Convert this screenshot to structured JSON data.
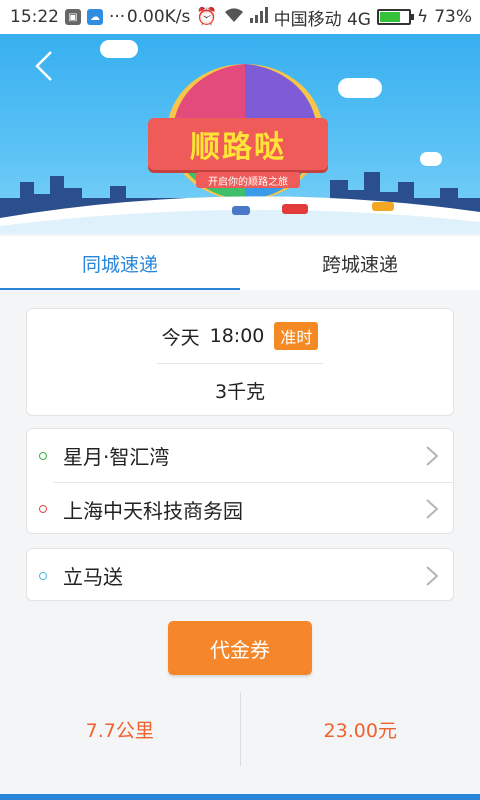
{
  "status_bar": {
    "time": "15:22",
    "dots": "···",
    "speed": "0.00K/s",
    "carrier": "中国移动 4G",
    "battery": "73%",
    "battery_level": 0.73
  },
  "banner": {
    "title": "顺路哒",
    "subtitle": "开启你的顺路之旅",
    "colors": {
      "sky": "#37aff0",
      "ribbon": "#ef5b58",
      "title_text": "#ffe437"
    }
  },
  "icons": {
    "back": "chevron-left-icon",
    "row_arrow": "chevron-right-icon"
  },
  "tabs": [
    {
      "label": "同城速递",
      "active": true
    },
    {
      "label": "跨城速递",
      "active": false
    }
  ],
  "delivery": {
    "day": "今天",
    "time": "18:00",
    "badge": "准时",
    "weight": "3千克"
  },
  "addresses": {
    "from": "星月·智汇湾",
    "to": "上海中天科技商务园"
  },
  "service": "立马送",
  "coupon_button": "代金券",
  "summary": {
    "distance": "7.7公里",
    "price": "23.00元"
  },
  "accent_colors": {
    "primary": "#2a86d8",
    "orange": "#f58a24",
    "price": "#f0612e"
  }
}
